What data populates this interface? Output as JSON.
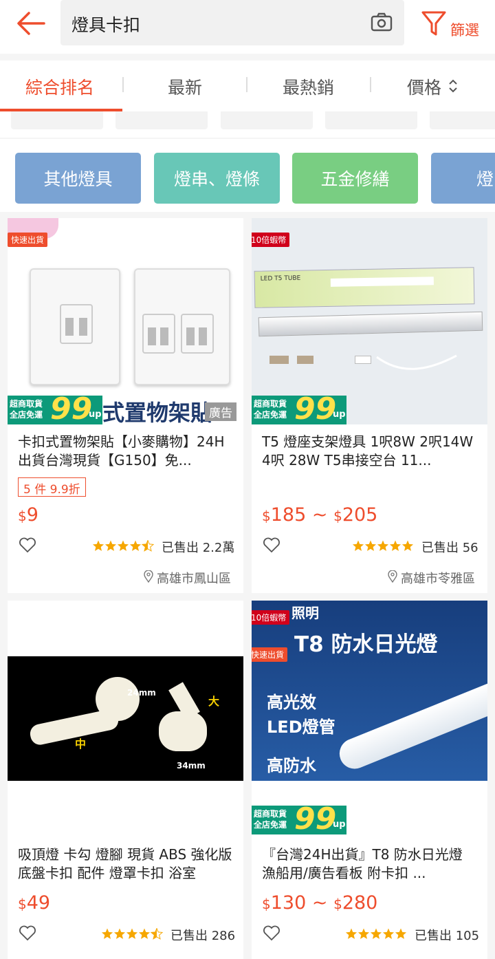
{
  "search": {
    "query": "燈具卡扣"
  },
  "filter": {
    "label": "篩選"
  },
  "tabs": [
    {
      "label": "綜合排名"
    },
    {
      "label": "最新"
    },
    {
      "label": "最熱銷"
    },
    {
      "label": "價格"
    }
  ],
  "categories": [
    {
      "label": "其他燈具",
      "color": "#7aa3d3"
    },
    {
      "label": "燈串、燈條",
      "color": "#68c7b7"
    },
    {
      "label": "五金修繕",
      "color": "#79ce82"
    },
    {
      "label": "燈",
      "color": "#7aa3d3"
    }
  ],
  "colors": {
    "accent": "#ee4d2d",
    "star": "#f6a700"
  },
  "products": [
    {
      "title": "卡扣式置物架貼【小麥購物】24H出貨台灣現貨【G150】免...",
      "tag": "快速出貨",
      "ad": "廣告",
      "banner_text": "式置物架貼",
      "discount": "5 件 9.9折",
      "price_prefix": "$",
      "price": "9",
      "price_to": "",
      "rating": 4.5,
      "sold": "已售出 2.2萬",
      "location": "高雄市鳳山區"
    },
    {
      "title": "T5 燈座支架燈具 1呎8W 2呎14W 4呎 28W T5串接空台 11...",
      "tag": "10倍蝦幣",
      "box_text": "LED T5 TUBE",
      "price_prefix": "$",
      "price": "185",
      "price_to": "205",
      "rating": 5,
      "sold": "已售出 56",
      "location": "高雄市苓雅區"
    },
    {
      "title": "吸頂燈 卡勾 燈腳 現貨 ABS 強化版 底盤卡扣 配件 燈罩卡扣 浴室",
      "dim_a": "24mm",
      "dim_b": "34mm",
      "label_big": "大",
      "label_mid": "中",
      "price_prefix": "$",
      "price": "49",
      "price_to": "",
      "rating": 4.5,
      "sold": "已售出 286"
    },
    {
      "title": "『台灣24H出貨』T8 防水日光燈 漁船用/廣告看板 附卡扣 ...",
      "tag": "10倍蝦幣",
      "tag2": "快速出貨",
      "brand": "照明",
      "headline": "T8 防水日光燈",
      "line1": "高光效",
      "line2": "LED燈管",
      "line3": "高防水",
      "price_prefix": "$",
      "price": "130",
      "price_to": "280",
      "rating": 5,
      "sold": "已售出 105"
    }
  ],
  "badge": {
    "line1": "超商取貨",
    "line2": "全店免運",
    "symbol": "$",
    "big": "99",
    "suffix": "up"
  },
  "tilde": "~"
}
